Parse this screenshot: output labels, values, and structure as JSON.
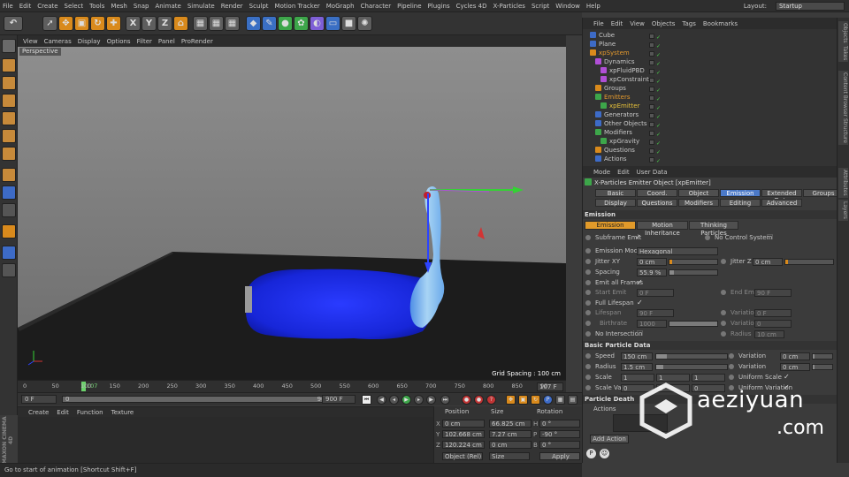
{
  "menubar": {
    "items": [
      "File",
      "Edit",
      "Create",
      "Select",
      "Tools",
      "Mesh",
      "Snap",
      "Animate",
      "Simulate",
      "Render",
      "Sculpt",
      "Motion Tracker",
      "MoGraph",
      "Character",
      "Pipeline",
      "Plugins",
      "Cycles 4D",
      "X-Particles",
      "Script",
      "Window",
      "Help"
    ],
    "layout_label": "Layout:",
    "layout_value": "Startup"
  },
  "toolbar": {
    "axis_x": "X",
    "axis_y": "Y",
    "axis_z": "Z"
  },
  "viewport": {
    "menu": [
      "View",
      "Cameras",
      "Display",
      "Options",
      "Filter",
      "Panel",
      "ProRender"
    ],
    "label": "Perspective",
    "grid_spacing": "Grid Spacing : 100 cm",
    "floor_color": "#1e1e1e",
    "bg_color": "#7c7c7c",
    "particle_color": "#1f2ee6"
  },
  "timeline": {
    "ticks": [
      "0",
      "50",
      "100",
      "150",
      "200",
      "250",
      "300",
      "350",
      "400",
      "450",
      "500",
      "550",
      "600",
      "650",
      "700",
      "750",
      "800",
      "850",
      "90"
    ],
    "current_marker": "107",
    "end_frame": "107 F"
  },
  "transport": {
    "start": "0 F",
    "slider_start": "0",
    "slider_end": "900",
    "end": "900 F"
  },
  "material_menu": [
    "Create",
    "Edit",
    "Function",
    "Texture"
  ],
  "maxon_logo": "MAXON CINEMA 4D",
  "coords": {
    "headers": [
      "Position",
      "Size",
      "Rotation"
    ],
    "rows": [
      {
        "axis": "X",
        "pos": "0 cm",
        "size": "66.825 cm",
        "rlabel": "H",
        "rot": "0 °"
      },
      {
        "axis": "Y",
        "pos": "102.668 cm",
        "size": "7.27 cm",
        "rlabel": "P",
        "rot": "-90 °"
      },
      {
        "axis": "Z",
        "pos": "120.224 cm",
        "size": "0 cm",
        "rlabel": "B",
        "rot": "0 °"
      }
    ],
    "mode": "Object (Rel)",
    "size_mode": "Size",
    "apply": "Apply"
  },
  "status": "Go to start of animation [Shortcut Shift+F]",
  "objects": {
    "menu": [
      "File",
      "Edit",
      "View",
      "Objects",
      "Tags",
      "Bookmarks"
    ],
    "rows": [
      {
        "name": "Cube",
        "indent": 0,
        "color": "",
        "icon": "#3d6bc7"
      },
      {
        "name": "Plane",
        "indent": 0,
        "color": "",
        "icon": "#3d6bc7"
      },
      {
        "name": "xpSystem",
        "indent": 0,
        "color": "orange",
        "icon": "#d98a1c"
      },
      {
        "name": "Dynamics",
        "indent": 1,
        "color": "",
        "icon": "#b04fd6"
      },
      {
        "name": "xpFluidPBD",
        "indent": 2,
        "color": "",
        "icon": "#b04fd6"
      },
      {
        "name": "xpConstraints",
        "indent": 2,
        "color": "",
        "icon": "#b04fd6"
      },
      {
        "name": "Groups",
        "indent": 1,
        "color": "",
        "icon": "#d98a1c"
      },
      {
        "name": "Emitters",
        "indent": 1,
        "color": "orange",
        "icon": "#3da64a"
      },
      {
        "name": "xpEmitter",
        "indent": 2,
        "color": "yellow",
        "icon": "#3da64a"
      },
      {
        "name": "Generators",
        "indent": 1,
        "color": "",
        "icon": "#3d6bc7"
      },
      {
        "name": "Other Objects",
        "indent": 1,
        "color": "",
        "icon": "#3d6bc7"
      },
      {
        "name": "Modifiers",
        "indent": 1,
        "color": "",
        "icon": "#3da64a"
      },
      {
        "name": "xpGravity",
        "indent": 2,
        "color": "",
        "icon": "#3da64a"
      },
      {
        "name": "Questions",
        "indent": 1,
        "color": "",
        "icon": "#d98a1c"
      },
      {
        "name": "Actions",
        "indent": 1,
        "color": "",
        "icon": "#3d6bc7"
      }
    ]
  },
  "attributes": {
    "menu": [
      "Mode",
      "Edit",
      "User Data"
    ],
    "title": "X-Particles Emitter Object [xpEmitter]",
    "tabs_row1": [
      "Basic",
      "Coord.",
      "Object",
      "Emission",
      "Extended Data",
      "Groups"
    ],
    "tabs_row2": [
      "Display",
      "Questions",
      "Modifiers",
      "Editing",
      "Advanced"
    ],
    "section_emission": "Emission",
    "subtabs": [
      "Emission",
      "Motion Inheritance",
      "Thinking Particles"
    ],
    "subframe_emit": "Subframe Emit",
    "no_control_system": "No Control System",
    "emission_mode_label": "Emission Mode",
    "emission_mode_value": "Hexagonal",
    "jitter_xy_label": "Jitter XY",
    "jitter_xy_value": "0 cm",
    "jitter_z_label": "Jitter Z",
    "jitter_z_value": "0 cm",
    "spacing_label": "Spacing",
    "spacing_value": "55.9 %",
    "spacing_pct": 0.1,
    "emit_all_frames": "Emit all Frames",
    "start_emit_label": "Start Emit",
    "start_emit_value": "0 F",
    "end_emit_label": "End Emit",
    "end_emit_value": "90 F",
    "full_lifespan": "Full Lifespan",
    "lifespan_label": "Lifespan",
    "lifespan_value": "90 F",
    "lifespan_var_label": "Variation",
    "lifespan_var_value": "0 F",
    "birthrate_label": "Birthrate",
    "birthrate_value": "1000",
    "birthrate_var_label": "Variation",
    "birthrate_var_value": "0",
    "no_intersection": "No Intersection",
    "radius_label": "Radius",
    "radius_value": "10 cm",
    "section_basic": "Basic Particle Data",
    "speed_label": "Speed",
    "speed_value": "150 cm",
    "speed_var_label": "Variation",
    "speed_var_value": "0 cm",
    "pradius_label": "Radius",
    "pradius_value": "1.5 cm",
    "pradius_var_label": "Variation",
    "pradius_var_value": "0 cm",
    "scale_label": "Scale",
    "scale_values": [
      "1",
      "1",
      "1"
    ],
    "uniform_scale": "Uniform Scale",
    "scale_var_label": "Scale Var.",
    "scale_var_values": [
      "0",
      "0",
      "0"
    ],
    "uniform_variation": "Uniform Variation",
    "section_death": "Particle Death",
    "actions_label": "Actions",
    "add_action": "Add Action"
  },
  "sidetabs": [
    "Objects",
    "Takes",
    "Content Browser",
    "Structure",
    "Attributes",
    "Layers"
  ],
  "watermark": {
    "brand": "aeziyuan",
    "suffix": ".com"
  }
}
